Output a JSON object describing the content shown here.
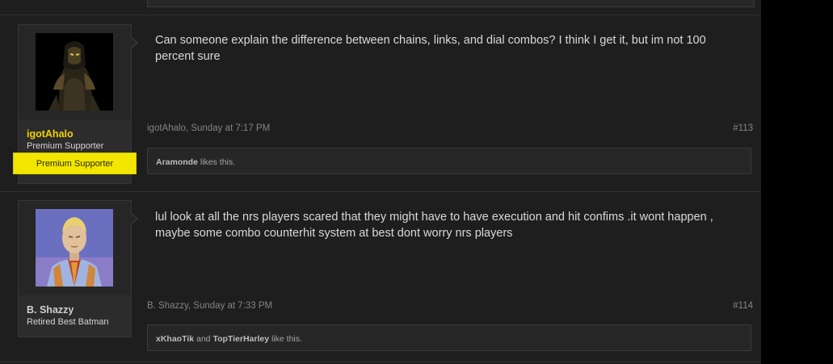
{
  "posts": [
    {
      "author": "igotAhalo",
      "user_title": "Premium Supporter",
      "banner": "Premium Supporter",
      "message": "Can someone explain the difference between chains, links, and dial combos? I think I get it, but im not 100 percent sure",
      "meta": "igotAhalo, Sunday at 7:17 PM",
      "number": "#113",
      "likes_user": "Aramonde",
      "likes_suffix": " likes this."
    },
    {
      "author": "B. Shazzy",
      "user_title": "Retired Best Batman",
      "message": "lul look at all the nrs players scared that they might have to have execution and hit confims .it wont happen , maybe some combo counterhit system at best dont worry nrs players",
      "meta": "B. Shazzy, Sunday at 7:33 PM",
      "number": "#114",
      "likes_user1": "xKhaoTik",
      "likes_and": " and ",
      "likes_user2": "TopTierHarley",
      "likes_suffix": " like this."
    }
  ],
  "colors": {
    "author_highlight": "#f0d200",
    "author_normal": "#cfcfcf",
    "banner_bg": "#f2e600"
  }
}
